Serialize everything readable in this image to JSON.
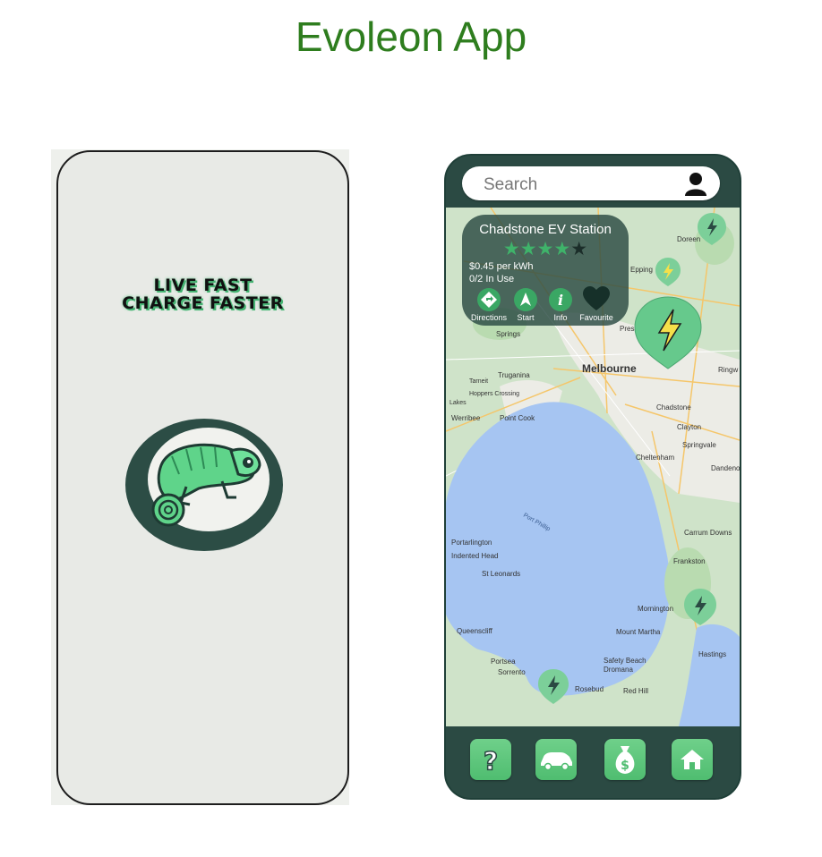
{
  "page": {
    "title": "Evoleon App"
  },
  "splash": {
    "tagline_line1": "LIVE FAST",
    "tagline_line2": "CHARGE FASTER",
    "logo_icon": "chameleon-logo-icon"
  },
  "map_screen": {
    "search": {
      "placeholder": "Search"
    },
    "station_card": {
      "name": "Chadstone EV Station",
      "rating": 4,
      "rating_max": 5,
      "price": "$0.45 per kWh",
      "usage": "0/2 In Use",
      "actions": [
        {
          "label": "Directions",
          "icon": "directions-icon"
        },
        {
          "label": "Start",
          "icon": "navigate-arrow-icon"
        },
        {
          "label": "Info",
          "icon": "info-icon"
        },
        {
          "label": "Favourite",
          "icon": "heart-icon"
        }
      ]
    },
    "map_labels": {
      "melbourne": "Melbourne",
      "port_phillip": "Port Phillip",
      "chadstone": "Chadstone",
      "clayton": "Clayton",
      "springvale": "Springvale",
      "cheltenham": "Cheltenham",
      "dandenong": "Dandeno",
      "carrum_downs": "Carrum Downs",
      "frankston": "Frankston",
      "mornington": "Mornington",
      "mount_martha": "Mount Martha",
      "safety_beach": "Safety Beach",
      "dromana": "Dromana",
      "red_hill": "Red Hill",
      "rosebud": "Rosebud",
      "sorrento": "Sorrento",
      "portsea": "Portsea",
      "queenscliff": "Queenscliff",
      "st_leonards": "St Leonards",
      "indented_head": "Indented Head",
      "portarlington": "Portarlington",
      "werribee": "Werribee",
      "point_cook": "Point Cook",
      "hoppers_crossing": "Hoppers Crossing",
      "tarneit": "Tarneit",
      "truganina": "Truganina",
      "epping": "Epping",
      "doreen": "Doreen",
      "hastings": "Hastings",
      "ringwood": "Ringw",
      "springs": "Springs",
      "preston": "Presto",
      "lakes": "Lakes"
    },
    "nav": [
      {
        "name": "help",
        "icon": "question-icon"
      },
      {
        "name": "car",
        "icon": "car-icon"
      },
      {
        "name": "money",
        "icon": "money-bag-icon"
      },
      {
        "name": "home",
        "icon": "home-icon"
      }
    ]
  },
  "colors": {
    "title_green": "#2e7d1e",
    "dark_teal": "#2b4a43",
    "accent_green": "#3fb36a",
    "water": "#a6c5f2",
    "land": "#cfe3c9"
  }
}
